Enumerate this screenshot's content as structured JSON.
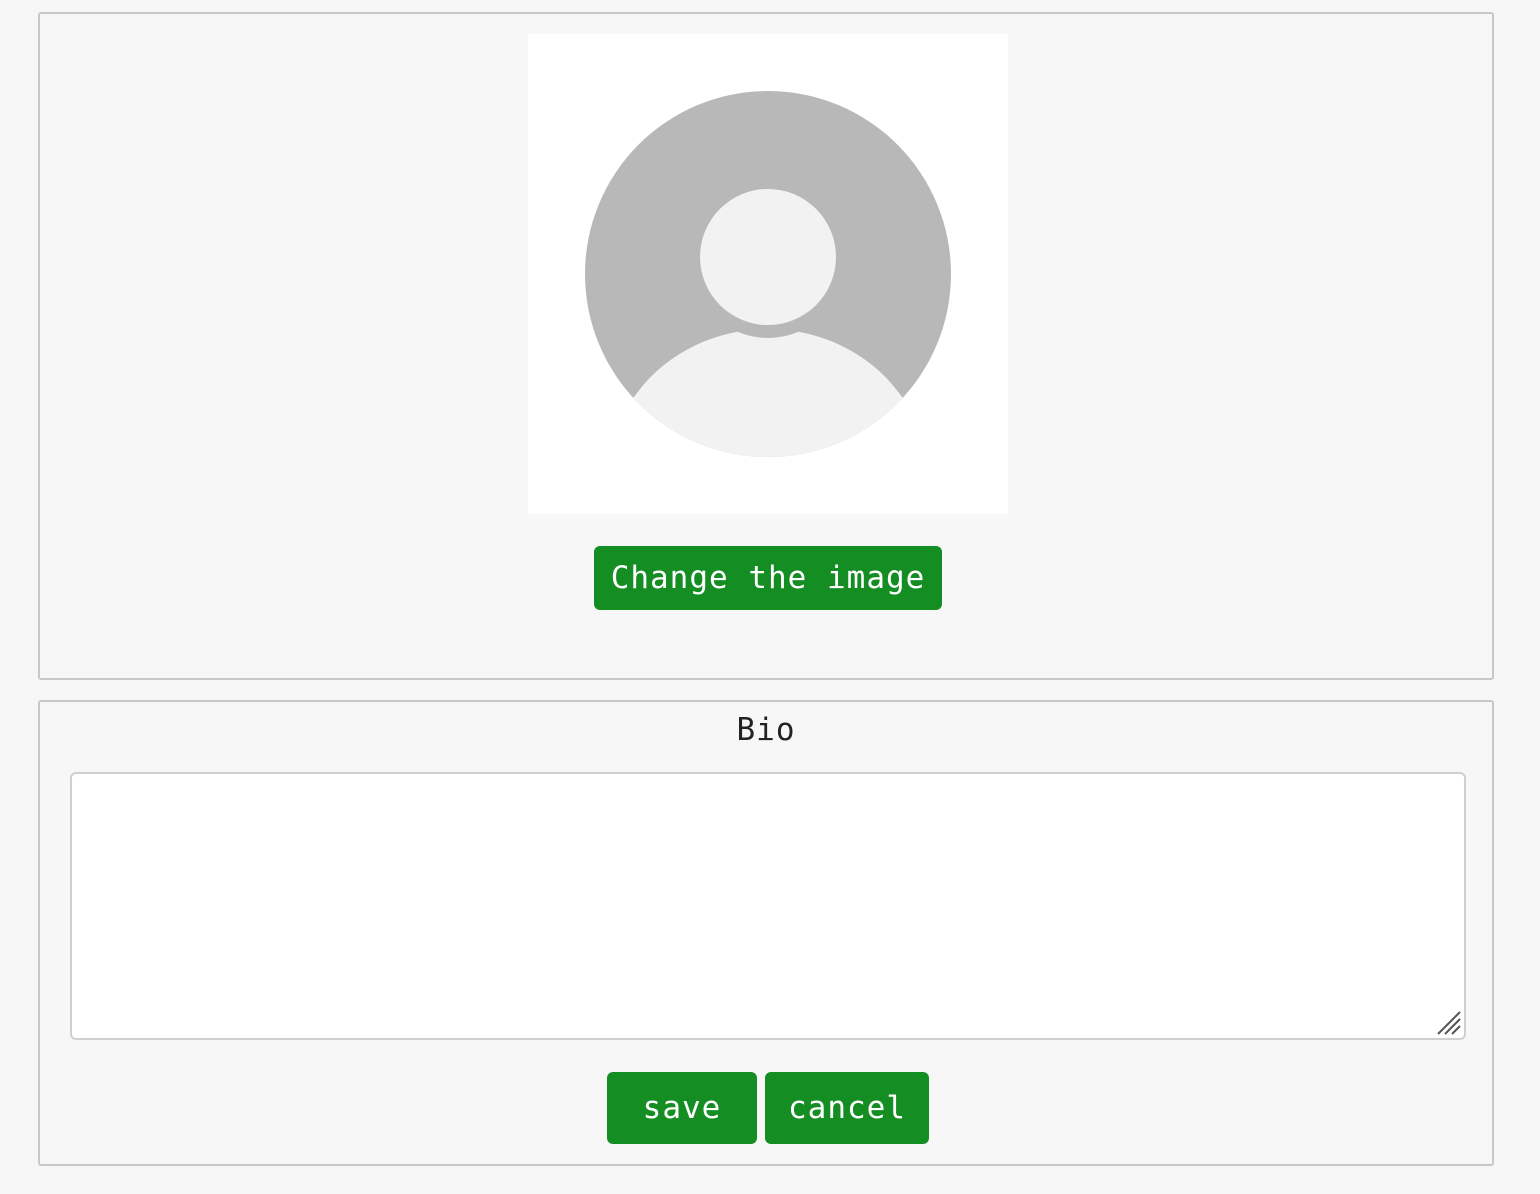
{
  "avatar": {
    "icon": "default-user-avatar-icon",
    "circle_color": "#b8b8b8",
    "silhouette_color": "#f2f2f2"
  },
  "image_section": {
    "change_button_label": "Change the image"
  },
  "bio_section": {
    "title": "Bio",
    "textarea_value": "",
    "textarea_placeholder": "",
    "save_label": "save",
    "cancel_label": "cancel"
  },
  "colors": {
    "accent": "#148d22",
    "page_background": "#f7f7f7",
    "panel_border": "#c8c8c8"
  }
}
